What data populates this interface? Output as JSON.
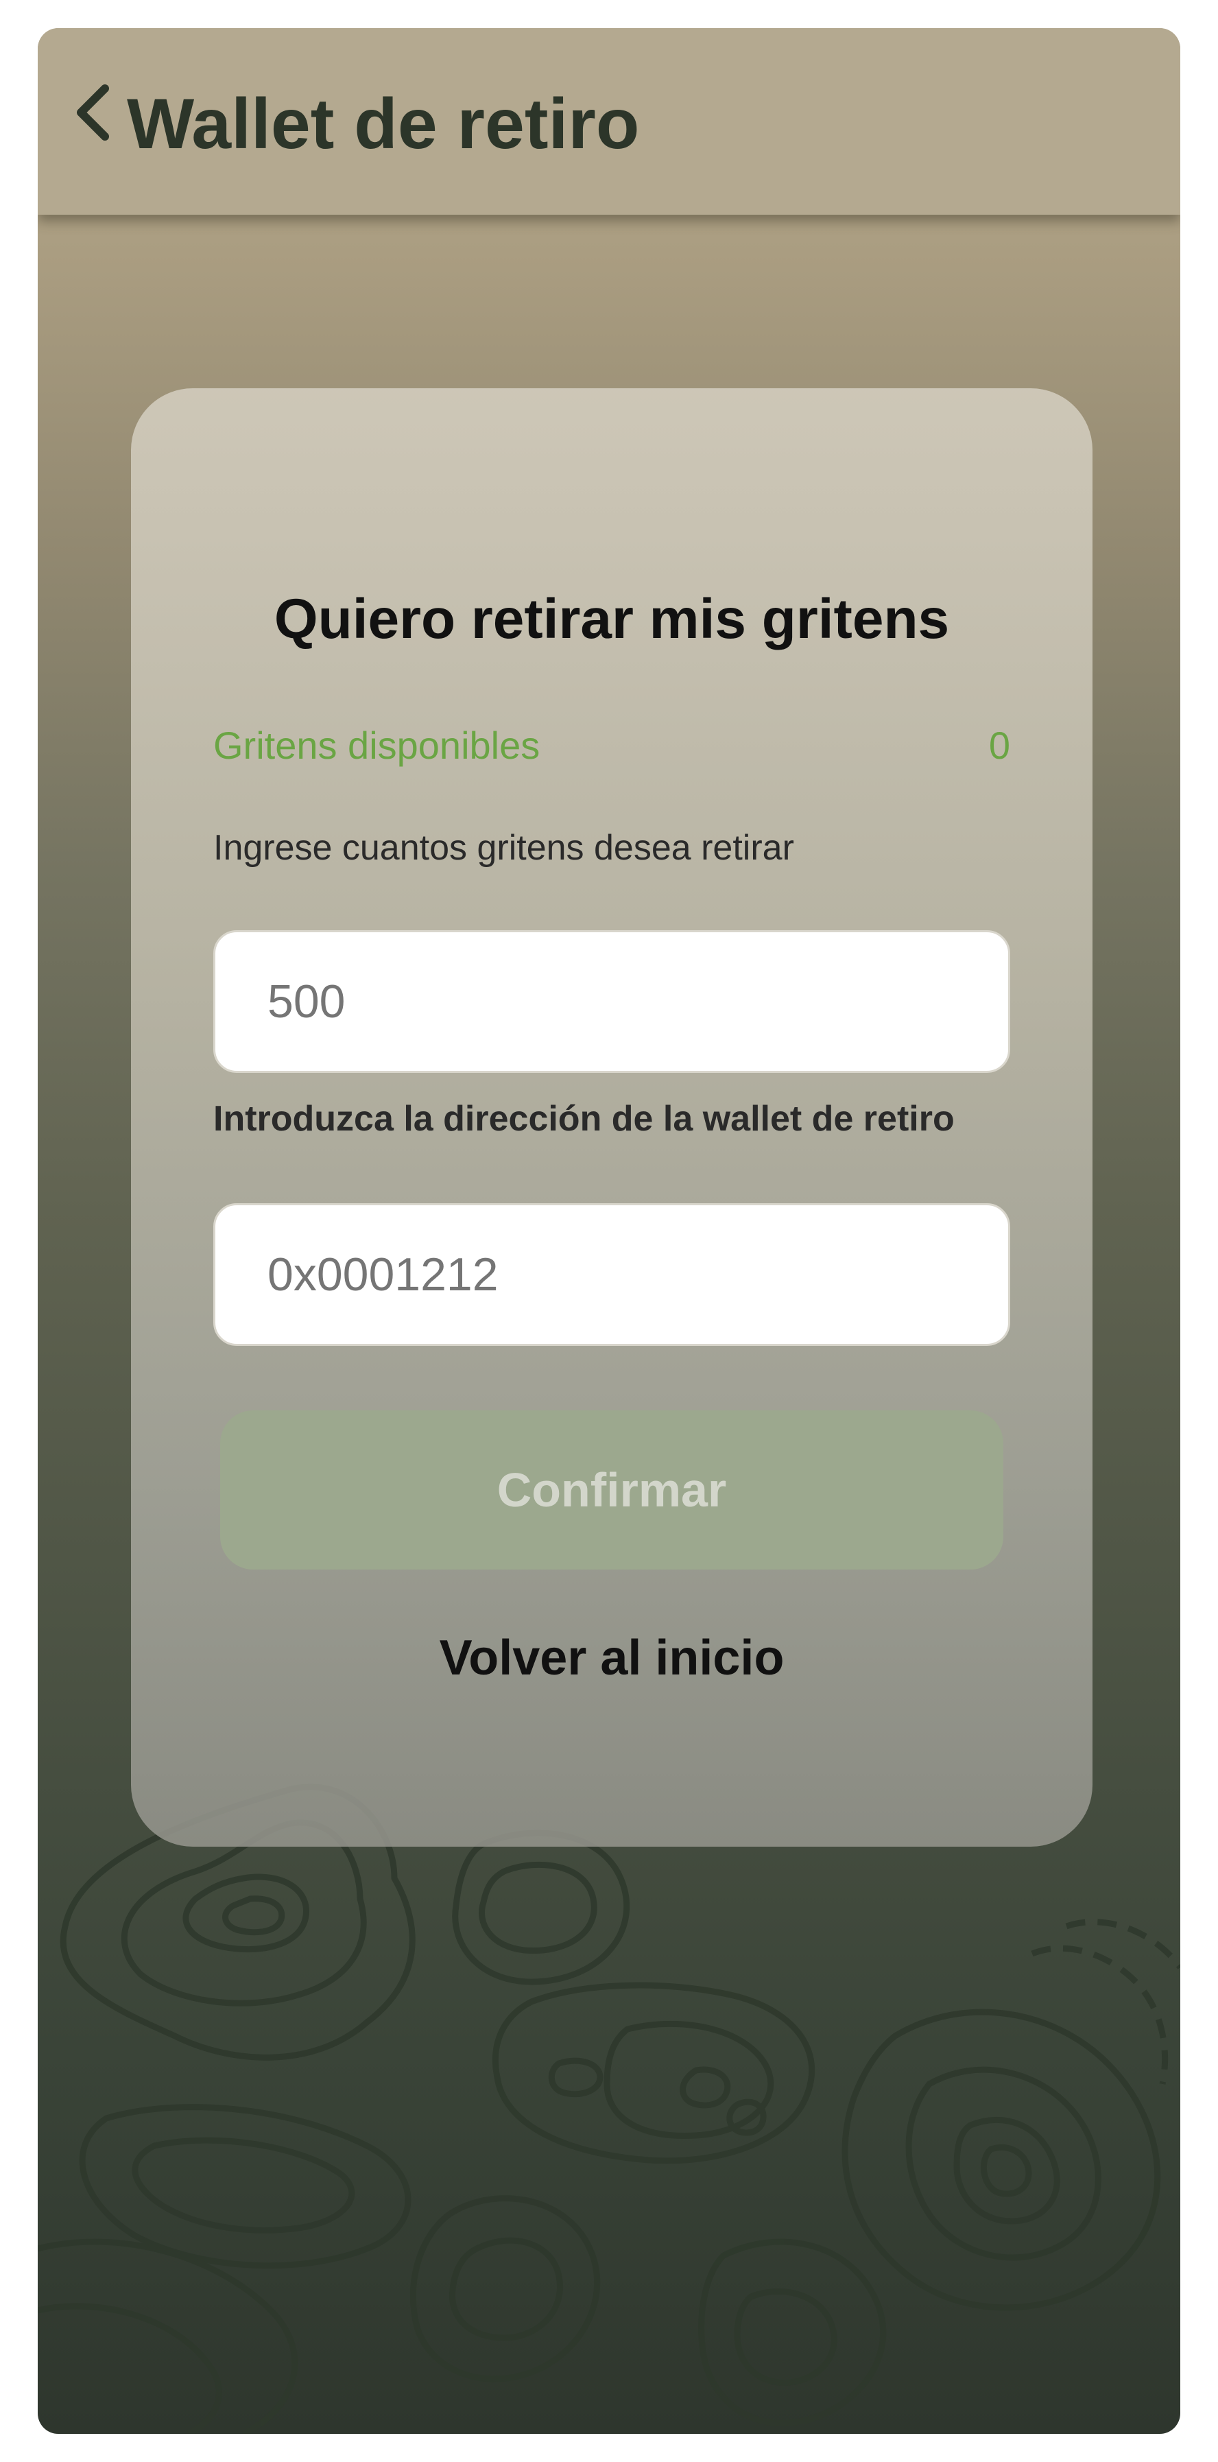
{
  "header": {
    "title": "Wallet de retiro",
    "back_icon": "chevron-left-icon"
  },
  "card": {
    "title": "Quiero retirar mis gritens",
    "available_label": "Gritens disponibles",
    "available_value": "0",
    "amount_label": "Ingrese cuantos gritens desea retirar",
    "amount_placeholder": "500",
    "address_label": "Introduzca la dirección de la wallet de retiro",
    "address_placeholder": "0x0001212",
    "confirm_label": "Confirmar",
    "home_label": "Volver al inicio"
  },
  "colors": {
    "header_bg": "#b4a990",
    "title_text": "#2c3529",
    "available_green": "#6aa544",
    "confirm_disabled_bg": "#9ca88e",
    "confirm_disabled_text": "#d3d6cb"
  },
  "decoration": "topographic-lines"
}
